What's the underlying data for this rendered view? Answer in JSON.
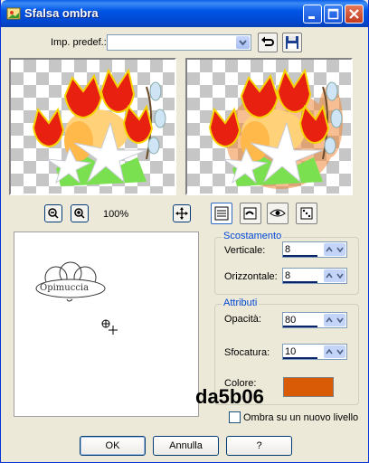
{
  "window": {
    "title": "Sfalsa ombra"
  },
  "presets": {
    "label": "Imp. predef.:",
    "value": ""
  },
  "zoom": {
    "level": "100%"
  },
  "offset": {
    "group_label": "Scostamento",
    "vertical_label": "Verticale:",
    "vertical_value": "8",
    "horizontal_label": "Orizzontale:",
    "horizontal_value": "8"
  },
  "attributes": {
    "group_label": "Attributi",
    "opacity_label": "Opacità:",
    "opacity_value": "80",
    "blur_label": "Sfocatura:",
    "blur_value": "10",
    "color_label": "Colore:",
    "color_value": "#da5b06",
    "color_hex_text": "da5b06"
  },
  "new_layer": {
    "label": "Ombra su un nuovo livello",
    "checked": false
  },
  "preview_watermark": "Opimuccia",
  "buttons": {
    "ok": "OK",
    "cancel": "Annulla",
    "help": "?"
  }
}
